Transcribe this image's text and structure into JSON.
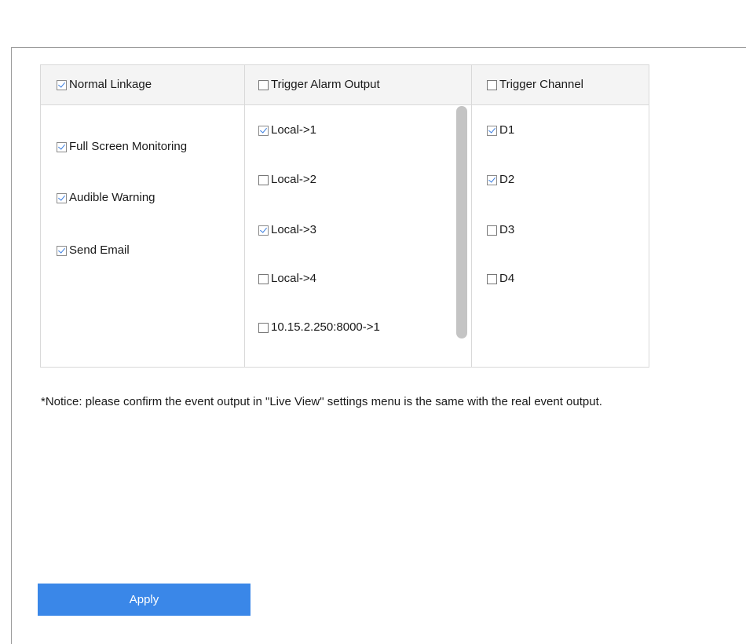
{
  "columns": {
    "normal_linkage": {
      "header": {
        "label": "Normal Linkage",
        "checked": true
      },
      "items": [
        {
          "label": "Full Screen Monitoring",
          "checked": true
        },
        {
          "label": "Audible Warning",
          "checked": true
        },
        {
          "label": "Send Email",
          "checked": true
        }
      ]
    },
    "trigger_alarm_output": {
      "header": {
        "label": "Trigger Alarm Output",
        "checked": false
      },
      "items": [
        {
          "label": "Local->1",
          "checked": true
        },
        {
          "label": "Local->2",
          "checked": false
        },
        {
          "label": "Local->3",
          "checked": true
        },
        {
          "label": "Local->4",
          "checked": false
        },
        {
          "label": "10.15.2.250:8000->1",
          "checked": false
        }
      ]
    },
    "trigger_channel": {
      "header": {
        "label": "Trigger Channel",
        "checked": false
      },
      "items": [
        {
          "label": "D1",
          "checked": true
        },
        {
          "label": "D2",
          "checked": true
        },
        {
          "label": "D3",
          "checked": false
        },
        {
          "label": "D4",
          "checked": false
        }
      ]
    }
  },
  "notice": "*Notice: please confirm the event output in \"Live View\" settings menu is the same with the real event output.",
  "apply_label": "Apply",
  "colors": {
    "accent": "#3a87e8",
    "check_mark": "#3a7de0",
    "header_bg": "#f4f4f4",
    "scrollbar": "#c4c4c4"
  }
}
